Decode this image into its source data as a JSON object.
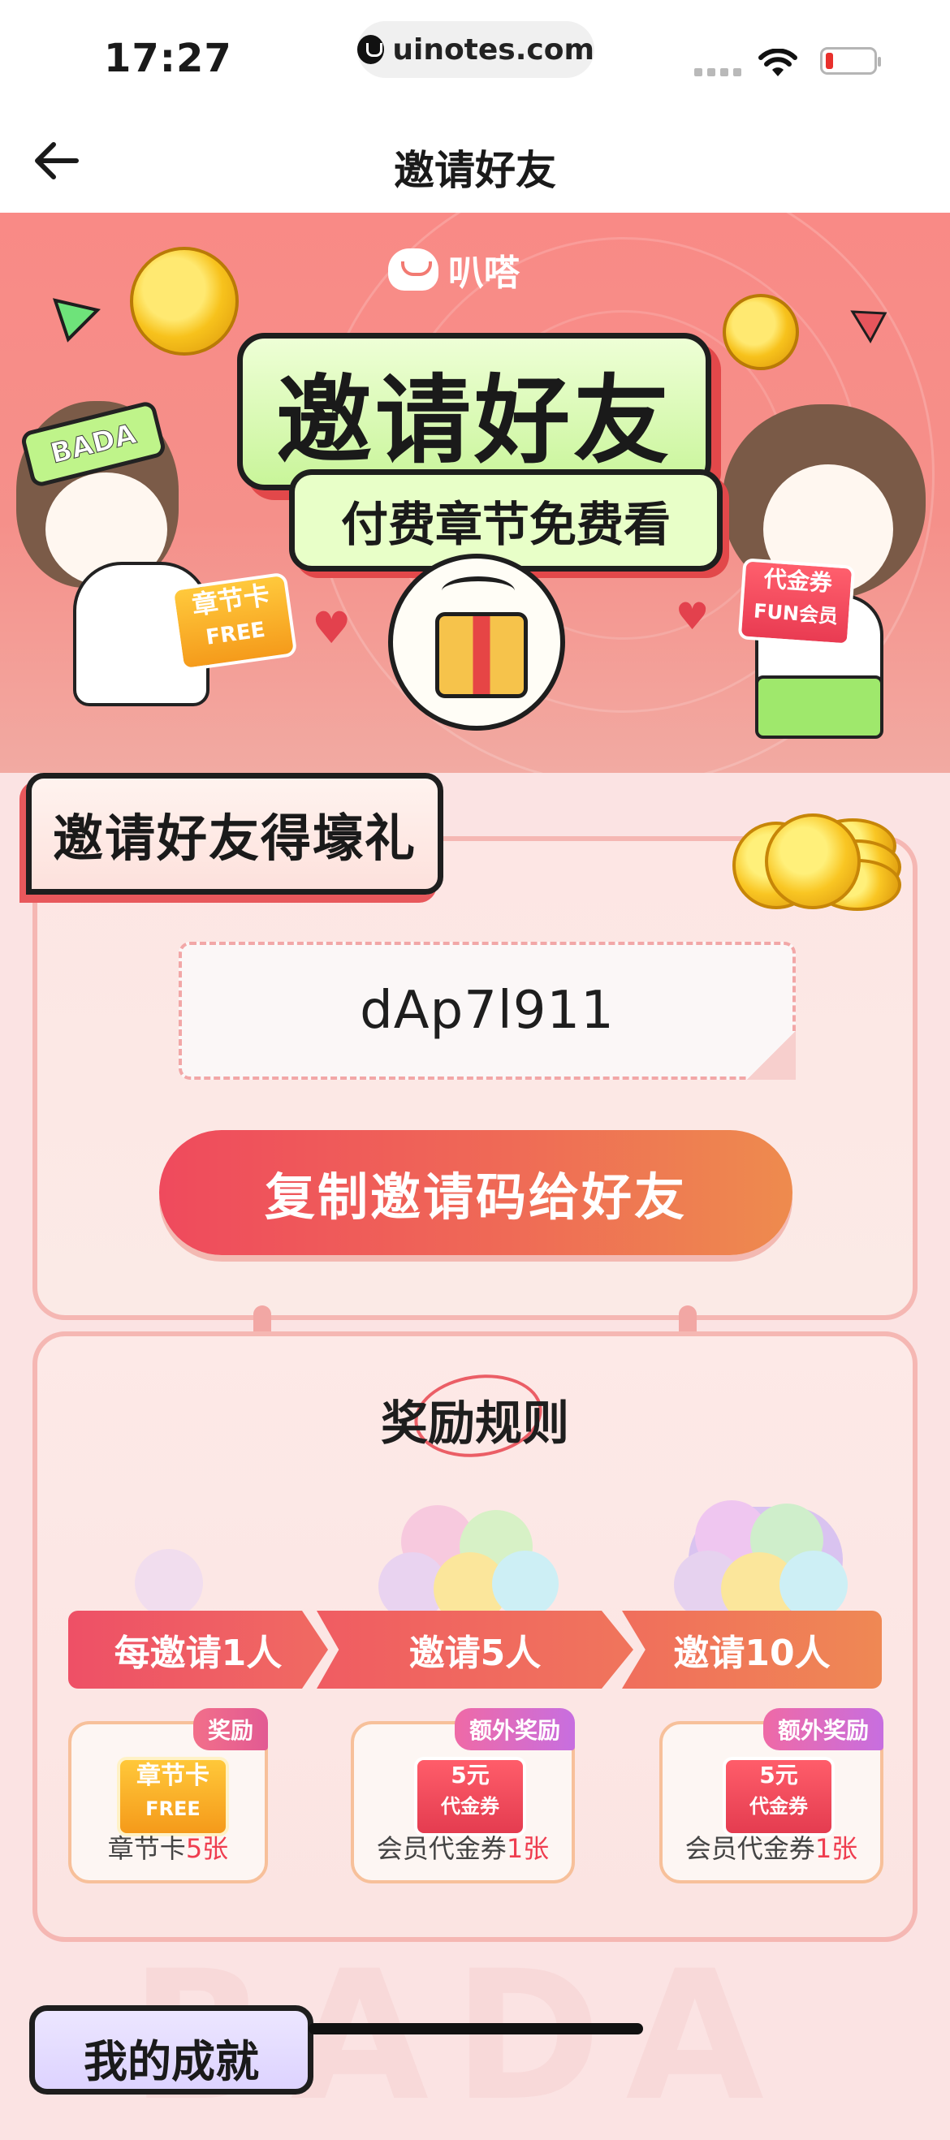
{
  "status_bar": {
    "time": "17:27",
    "url": "uinotes.com"
  },
  "nav": {
    "title": "邀请好友"
  },
  "banner": {
    "logo_text": "叭嗒",
    "headline": "邀请好友",
    "subheadline": "付费章节免费看",
    "left_band": "BADA",
    "left_tag_title": "章节卡",
    "left_tag_sub": "FREE",
    "right_tag_title": "代金券",
    "right_tag_sub": "FUN会员"
  },
  "invite": {
    "section_title": "邀请好友得壕礼",
    "invite_code": "dAp7l911",
    "copy_button": "复制邀请码给好友"
  },
  "rules": {
    "title": "奖励规则",
    "steps": [
      {
        "label": "每邀请1人"
      },
      {
        "label": "邀请5人"
      },
      {
        "label": "邀请10人"
      }
    ],
    "rewards": [
      {
        "badge": "奖励",
        "icon_title": "章节卡",
        "icon_sub": "FREE",
        "name": "章节卡",
        "count": "5张"
      },
      {
        "badge": "额外奖励",
        "icon_title": "5元",
        "icon_sub": "代金券",
        "name": "会员代金券",
        "count": "1张"
      },
      {
        "badge": "额外奖励",
        "icon_title": "5元",
        "icon_sub": "代金券",
        "name": "会员代金券",
        "count": "1张"
      }
    ],
    "watermark": "BADA"
  },
  "achievements": {
    "section_title": "我的成就"
  },
  "colors": {
    "primary_red": "#ef4a5d",
    "primary_orange": "#ee8b4e",
    "highlight": "#ef3d4f",
    "lime": "#c9f59a"
  }
}
